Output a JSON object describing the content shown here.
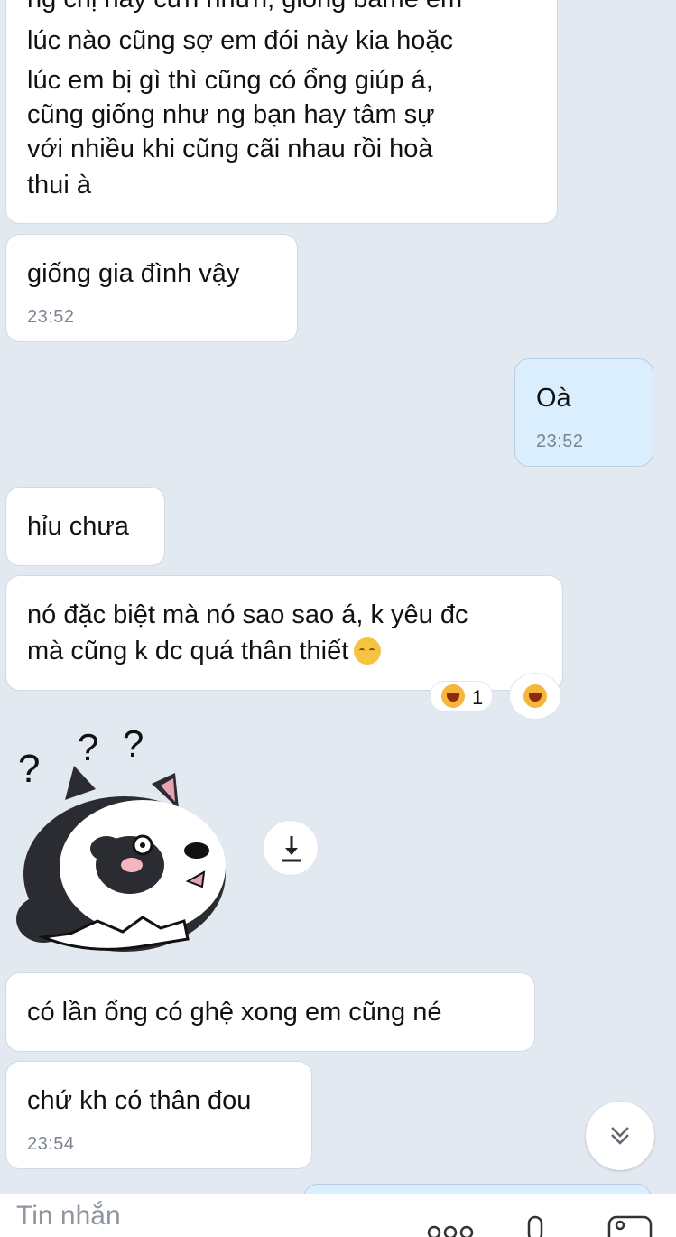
{
  "conversation": {
    "cut_top_text": "ng chị này cưn nhưn, giống bame em",
    "messages": [
      {
        "direction": "received",
        "lines": [
          "lúc nào cũng sợ em đói này kia hoặc",
          "lúc em bị gì thì cũng có ổng giúp á,",
          "cũng giống như ng bạn hay tâm sự",
          "với nhiều khi cũng cãi nhau rồi hoà",
          "thui à"
        ]
      },
      {
        "direction": "received",
        "text": "giống gia đình vậy",
        "time": "23:52"
      },
      {
        "direction": "sent",
        "text": "Oà",
        "time": "23:52"
      },
      {
        "direction": "received",
        "text": "hỉu chưa"
      },
      {
        "direction": "received",
        "lines": [
          "nó đặc biệt mà nó sao sao á, k yêu đc",
          "mà cũng k dc quá thân thiết"
        ],
        "emoji": "relieved-face-emoji",
        "reaction": {
          "emoji": "laughing-face-emoji",
          "count": "1"
        }
      },
      {
        "direction": "received",
        "type": "sticker",
        "sticker": "confused-husky-sticker",
        "marks": [
          "?",
          "?",
          "?"
        ]
      },
      {
        "direction": "received",
        "text": "có lần ổng có ghệ xong em cũng né"
      },
      {
        "direction": "received",
        "text": "chứ kh có thân đou",
        "time": "23:54"
      }
    ]
  },
  "composer": {
    "placeholder": "Tin nhắn"
  },
  "icons": {
    "download": "download-icon",
    "scroll_down": "double-chevron-down-icon",
    "more": "more-icon",
    "mic": "microphone-icon",
    "image": "image-icon"
  },
  "colors": {
    "background": "#e2e9f1",
    "received_bubble": "#ffffff",
    "sent_bubble": "#dbeefe",
    "timestamp": "#7c8590"
  }
}
